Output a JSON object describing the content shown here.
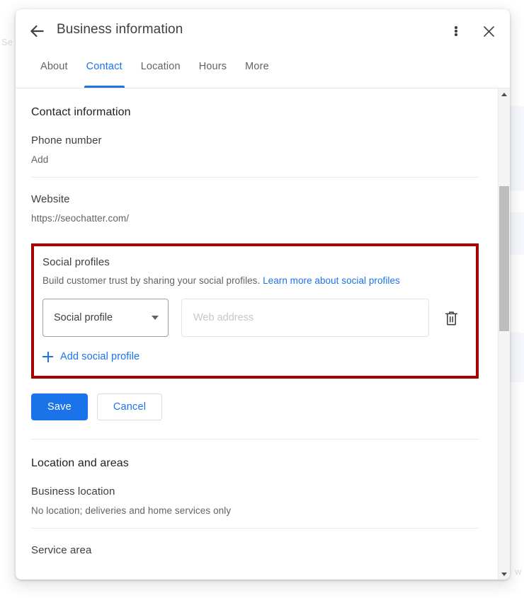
{
  "background": {
    "ghost_label_left": "Se",
    "ghost_label_right": "w"
  },
  "dialog": {
    "title": "Business information",
    "back_icon": "arrow-back-icon",
    "more_icon": "more-vert-icon",
    "close_icon": "close-icon",
    "tabs": [
      {
        "label": "About",
        "active": false
      },
      {
        "label": "Contact",
        "active": true
      },
      {
        "label": "Location",
        "active": false
      },
      {
        "label": "Hours",
        "active": false
      },
      {
        "label": "More",
        "active": false
      }
    ]
  },
  "contact": {
    "section_title": "Contact information",
    "phone": {
      "label": "Phone number",
      "value": "Add"
    },
    "website": {
      "label": "Website",
      "value": "https://seochatter.com/"
    },
    "social_profiles": {
      "title": "Social profiles",
      "description": "Build customer trust by sharing your social profiles.",
      "learn_more": "Learn more about social profiles",
      "select_value": "Social profile",
      "input_value": "",
      "input_placeholder": "Web address",
      "delete_icon": "trash-icon",
      "add_label": "Add social profile",
      "highlight_color": "#a50000"
    },
    "buttons": {
      "save": "Save",
      "cancel": "Cancel"
    }
  },
  "location": {
    "section_title": "Location and areas",
    "business_location": {
      "label": "Business location",
      "value": "No location; deliveries and home services only"
    },
    "service_area": {
      "label": "Service area"
    }
  },
  "theme": {
    "accent": "#1a73e8",
    "text_primary": "#202124",
    "text_secondary": "#5f6368"
  }
}
